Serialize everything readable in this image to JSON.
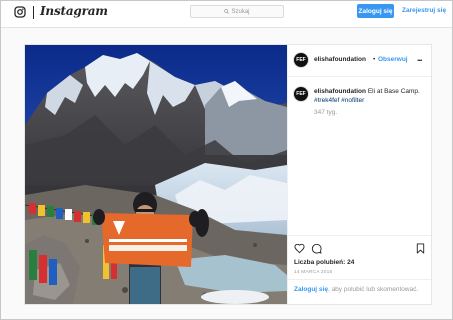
{
  "header": {
    "app_name": "Instagram",
    "search_placeholder": "Szukaj",
    "login_button": "Zaloguj się",
    "signup_link": "Zarejestruj się"
  },
  "post": {
    "avatar_text": "FEF",
    "username": "elishafoundation",
    "dot": "•",
    "follow_label": "Obserwuj",
    "more_label": "...",
    "caption_text": "Eli at Base Camp.",
    "hashtags": [
      "#trek4fef",
      "#nofilter"
    ],
    "time_ago": "347 tyg.",
    "likes_label": "Liczba polubień:",
    "likes_count": "24",
    "date": "14 MARCA 2015",
    "login_prompt_link": "Zaloguj się",
    "login_prompt_rest": ", aby polubić lub skomentować."
  },
  "icons": [
    "instagram-icon",
    "search-icon",
    "more-icon",
    "heart-icon",
    "comment-icon",
    "bookmark-icon"
  ],
  "colors": {
    "accent": "#3897f0",
    "hashtag": "#003569",
    "muted": "#999999",
    "background": "#fafafa"
  }
}
